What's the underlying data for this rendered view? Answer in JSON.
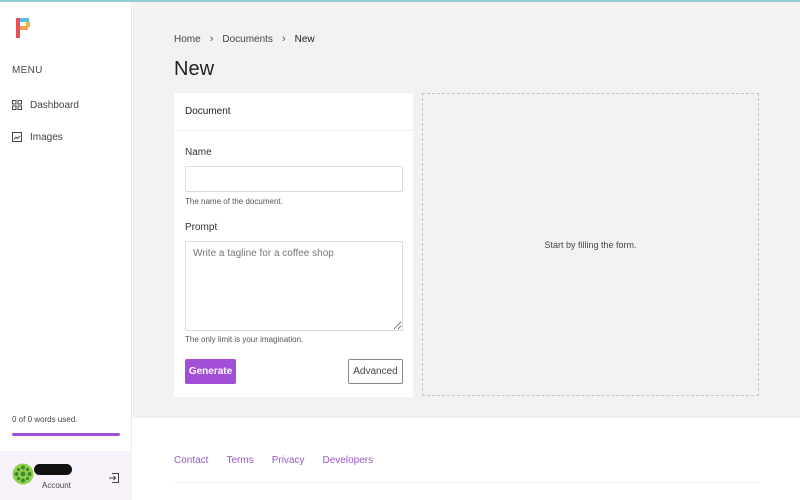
{
  "sidebar": {
    "logo_icon": "brand-logo-icon",
    "menu_heading": "MENU",
    "items": [
      {
        "label": "Dashboard",
        "icon": "grid-icon"
      },
      {
        "label": "Images",
        "icon": "image-icon"
      }
    ],
    "usage": {
      "text": "0 of 0 words used.",
      "fill_percent": 100
    },
    "account": {
      "label": "Account",
      "avatar_icon": "avatar-pattern-icon",
      "logout_icon": "logout-icon"
    }
  },
  "breadcrumb": {
    "items": [
      "Home",
      "Documents",
      "New"
    ],
    "separator_icon": "chevron-right-icon"
  },
  "page": {
    "title": "New"
  },
  "form": {
    "header": "Document",
    "name_label": "Name",
    "name_value": "",
    "name_help": "The name of the document.",
    "prompt_label": "Prompt",
    "prompt_value": "",
    "prompt_placeholder": "Write a tagline for a coffee shop",
    "prompt_help": "The only limit is your imagination.",
    "generate_label": "Generate",
    "advanced_label": "Advanced"
  },
  "preview": {
    "message": "Start by filling the form."
  },
  "footer": {
    "links": [
      "Contact",
      "Terms",
      "Privacy",
      "Developers"
    ]
  },
  "colors": {
    "accent": "#a14fd6",
    "footer_link": "#9b59c9",
    "main_bg": "#f2f2f2",
    "top_line": "#8ecfd6"
  }
}
